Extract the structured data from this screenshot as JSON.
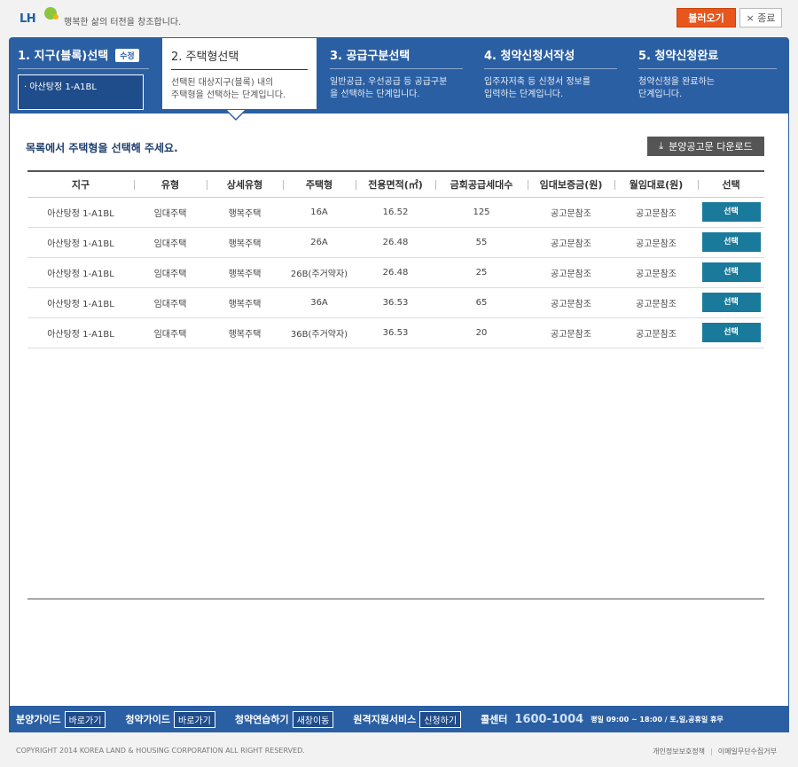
{
  "header": {
    "logo_text": "LH",
    "slogan": "행복한 삶의 터전을 창조합니다.",
    "load_button": "불러오기",
    "close_button": "× 종료"
  },
  "steps": [
    {
      "title": "1. 지구(블록)선택",
      "badge": "수정",
      "selected_block": "· 아산탕정 1-A1BL"
    },
    {
      "title": "2. 주택형선택",
      "desc": "선택된 대상지구(블록) 내의\n주택형을 선택하는 단계입니다."
    },
    {
      "title": "3. 공급구분선택",
      "desc": "일반공급, 우선공급 등 공급구분\n을 선택하는 단계입니다."
    },
    {
      "title": "4. 청약신청서작성",
      "desc": "입주자저축 등 신청서 정보를\n입력하는 단계입니다."
    },
    {
      "title": "5. 청약신청완료",
      "desc": "청약신청을 완료하는\n단계입니다."
    }
  ],
  "main": {
    "instruction": "목록에서 주택형을 선택해 주세요.",
    "download_button": "분양공고문 다운로드",
    "columns": [
      "지구",
      "유형",
      "상세유형",
      "주택형",
      "전용면적(㎡)",
      "금회공급세대수",
      "임대보증금(원)",
      "월임대료(원)",
      "선택"
    ],
    "select_label": "선택",
    "rows": [
      {
        "district": "아산탕정 1-A1BL",
        "type": "임대주택",
        "subtype": "행복주택",
        "unit": "16A",
        "area": "16.52",
        "count": "125",
        "deposit": "공고문참조",
        "rent": "공고문참조"
      },
      {
        "district": "아산탕정 1-A1BL",
        "type": "임대주택",
        "subtype": "행복주택",
        "unit": "26A",
        "area": "26.48",
        "count": "55",
        "deposit": "공고문참조",
        "rent": "공고문참조"
      },
      {
        "district": "아산탕정 1-A1BL",
        "type": "임대주택",
        "subtype": "행복주택",
        "unit": "26B(주거약자)",
        "area": "26.48",
        "count": "25",
        "deposit": "공고문참조",
        "rent": "공고문참조"
      },
      {
        "district": "아산탕정 1-A1BL",
        "type": "임대주택",
        "subtype": "행복주택",
        "unit": "36A",
        "area": "36.53",
        "count": "65",
        "deposit": "공고문참조",
        "rent": "공고문참조"
      },
      {
        "district": "아산탕정 1-A1BL",
        "type": "임대주택",
        "subtype": "행복주택",
        "unit": "36B(주거약자)",
        "area": "36.53",
        "count": "20",
        "deposit": "공고문참조",
        "rent": "공고문참조"
      }
    ]
  },
  "footer": {
    "links": [
      {
        "label": "분양가이드",
        "button": "바로가기"
      },
      {
        "label": "청약가이드",
        "button": "바로가기"
      },
      {
        "label": "청약연습하기",
        "button": "새창이동"
      },
      {
        "label": "원격지원서비스",
        "button": "신청하기"
      }
    ],
    "call_label": "콜센터",
    "call_number": "1600-1004",
    "hours": "평일 09:00 ~ 18:00 / 토,일,공휴일 휴무",
    "copyright": "COPYRIGHT 2014 KOREA LAND & HOUSING CORPORATION ALL RIGHT RESERVED.",
    "privacy": "개인정보보호정책",
    "email_refuse": "이메일무단수집거부"
  },
  "colors": {
    "primary": "#2b5fa3",
    "accent_orange": "#e8561c",
    "select_button": "#1a7a9b"
  }
}
